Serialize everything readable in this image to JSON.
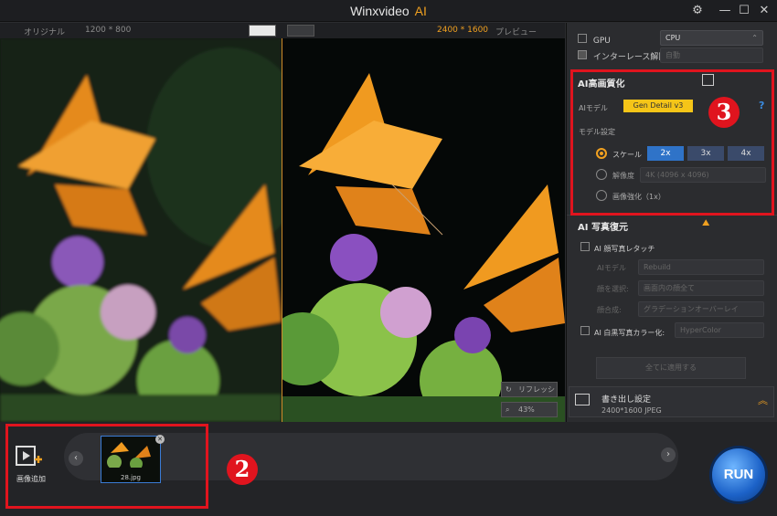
{
  "app": {
    "title": "Winxvideo",
    "title_ai": "AI"
  },
  "viewer": {
    "original_label": "オリジナル",
    "original_size": "1200 * 800",
    "output_size": "2400 * 1600",
    "preview_label": "プレビュー",
    "refresh_label": "リフレッシ",
    "zoom": "43%"
  },
  "settings": {
    "gpu_label": "GPU",
    "gpu_value": "CPU",
    "deinterlace_label": "インターレース解除",
    "deinterlace_value": "自動"
  },
  "enhance": {
    "title": "AI高画質化",
    "model_label": "AIモデル",
    "model_value": "Gen Detail v3",
    "help": "?",
    "settings_label": "モデル設定",
    "scale_label": "スケール",
    "scale_options": [
      "2x",
      "3x",
      "4x"
    ],
    "selected_scale": "2x",
    "resolution_label": "解像度",
    "resolution_value": "4K (4096 x 4096)",
    "quality_label": "画像強化（1x）"
  },
  "restore": {
    "title": "AI 写真復元",
    "face_label": "AI 顔写真レタッチ",
    "model_label": "AIモデル",
    "model_value": "Rebuild",
    "face_select_label": "顔を選択:",
    "face_select_value": "画面内の顔全て",
    "face_blend_label": "顔合成:",
    "face_blend_value": "グラデーションオーバーレイ",
    "colorize_label": "AI 白黒写真カラー化:",
    "colorize_value": "HyperColor",
    "apply_all": "全てに適用する"
  },
  "export": {
    "title": "書き出し設定",
    "detail": "2400*1600 JPEG"
  },
  "bottom": {
    "add_image": "画像追加",
    "thumb_name": "28.jpg",
    "run": "RUN"
  },
  "badges": {
    "b2": "2",
    "b3": "3"
  },
  "colors": {
    "accent": "#f0a020",
    "highlight_red": "#e0141e",
    "scale_selected": "#2f73c8",
    "model_badge": "#f5c518"
  }
}
